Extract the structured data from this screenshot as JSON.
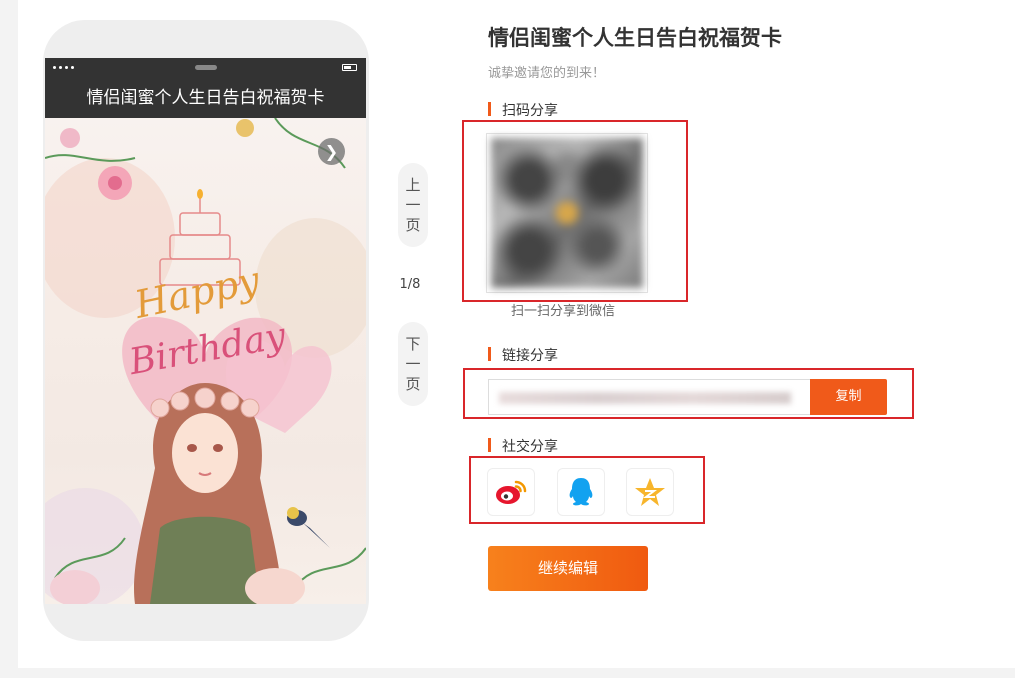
{
  "phone": {
    "header_title": "情侣闺蜜个人生日告白祝福贺卡",
    "card_image_alt": "Happy Birthday illustrated card with girl, flowers and cake"
  },
  "pager": {
    "prev_label_chars": [
      "上",
      "一",
      "页"
    ],
    "next_label_chars": [
      "下",
      "一",
      "页"
    ],
    "counter": "1/8"
  },
  "main": {
    "title": "情侣闺蜜个人生日告白祝福贺卡",
    "subtitle": "诚挚邀请您的到来！",
    "qr_section": {
      "label": "扫码分享",
      "caption": "扫一扫分享到微信"
    },
    "link_section": {
      "label": "链接分享",
      "copy_label": "复制"
    },
    "social_section": {
      "label": "社交分享",
      "icons": [
        "weibo-icon",
        "qq-icon",
        "qzone-icon"
      ]
    },
    "continue_label": "继续编辑"
  },
  "colors": {
    "accent": "#f05a1a",
    "highlight_box": "#d9262a",
    "phone_bar": "#333333"
  }
}
